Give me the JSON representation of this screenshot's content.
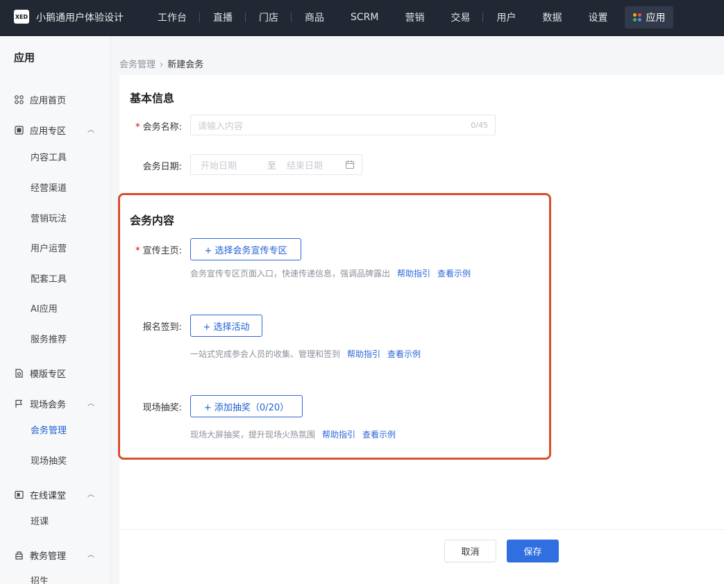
{
  "topbar": {
    "logo_text": "XED",
    "brand": "小鹅通用户体验设计",
    "nav": [
      "工作台",
      "直播",
      "门店",
      "商品",
      "SCRM",
      "营销",
      "交易",
      "用户",
      "数据",
      "设置"
    ],
    "active_nav": "应用"
  },
  "sidebar": {
    "title": "应用",
    "home": "应用首页",
    "app_zone": "应用专区",
    "app_zone_items": [
      "内容工具",
      "经营渠道",
      "营销玩法",
      "用户运营",
      "配套工具",
      "AI应用",
      "服务推荐"
    ],
    "template_zone": "模版专区",
    "onsite_meeting": "现场会务",
    "onsite_items": [
      "会务管理",
      "现场抽奖"
    ],
    "online_class": "在线课堂",
    "online_items": [
      "班课"
    ],
    "edu_admin": "教务管理",
    "edu_items": [
      "招生"
    ]
  },
  "breadcrumb": {
    "parent": "会务管理",
    "current": "新建会务"
  },
  "basic": {
    "title": "基本信息",
    "name_label": "会务名称:",
    "name_placeholder": "请输入内容",
    "name_count": "0/45",
    "date_label": "会务日期:",
    "date_start": "开始日期",
    "date_to": "至",
    "date_end": "结束日期"
  },
  "meeting_content": {
    "title": "会务内容",
    "promo": {
      "label": "宣传主页:",
      "button": "+ 选择会务宣传专区",
      "hint": "会务宣传专区页面入口，快速传递信息，强调品牌露出",
      "help": "帮助指引",
      "example": "查看示例"
    },
    "signup": {
      "label": "报名签到:",
      "button": "+ 选择活动",
      "hint": "一站式完成参会人员的收集、管理和签到",
      "help": "帮助指引",
      "example": "查看示例"
    },
    "lottery": {
      "label": "现场抽奖:",
      "button": "+ 添加抽奖（0/20）",
      "hint": "现场大屏抽奖，提升现场火热氛围",
      "help": "帮助指引",
      "example": "查看示例"
    }
  },
  "footer": {
    "cancel": "取消",
    "save": "保存"
  },
  "colors": {
    "accent": "#2f6fe0",
    "highlight": "#d84f2c"
  }
}
